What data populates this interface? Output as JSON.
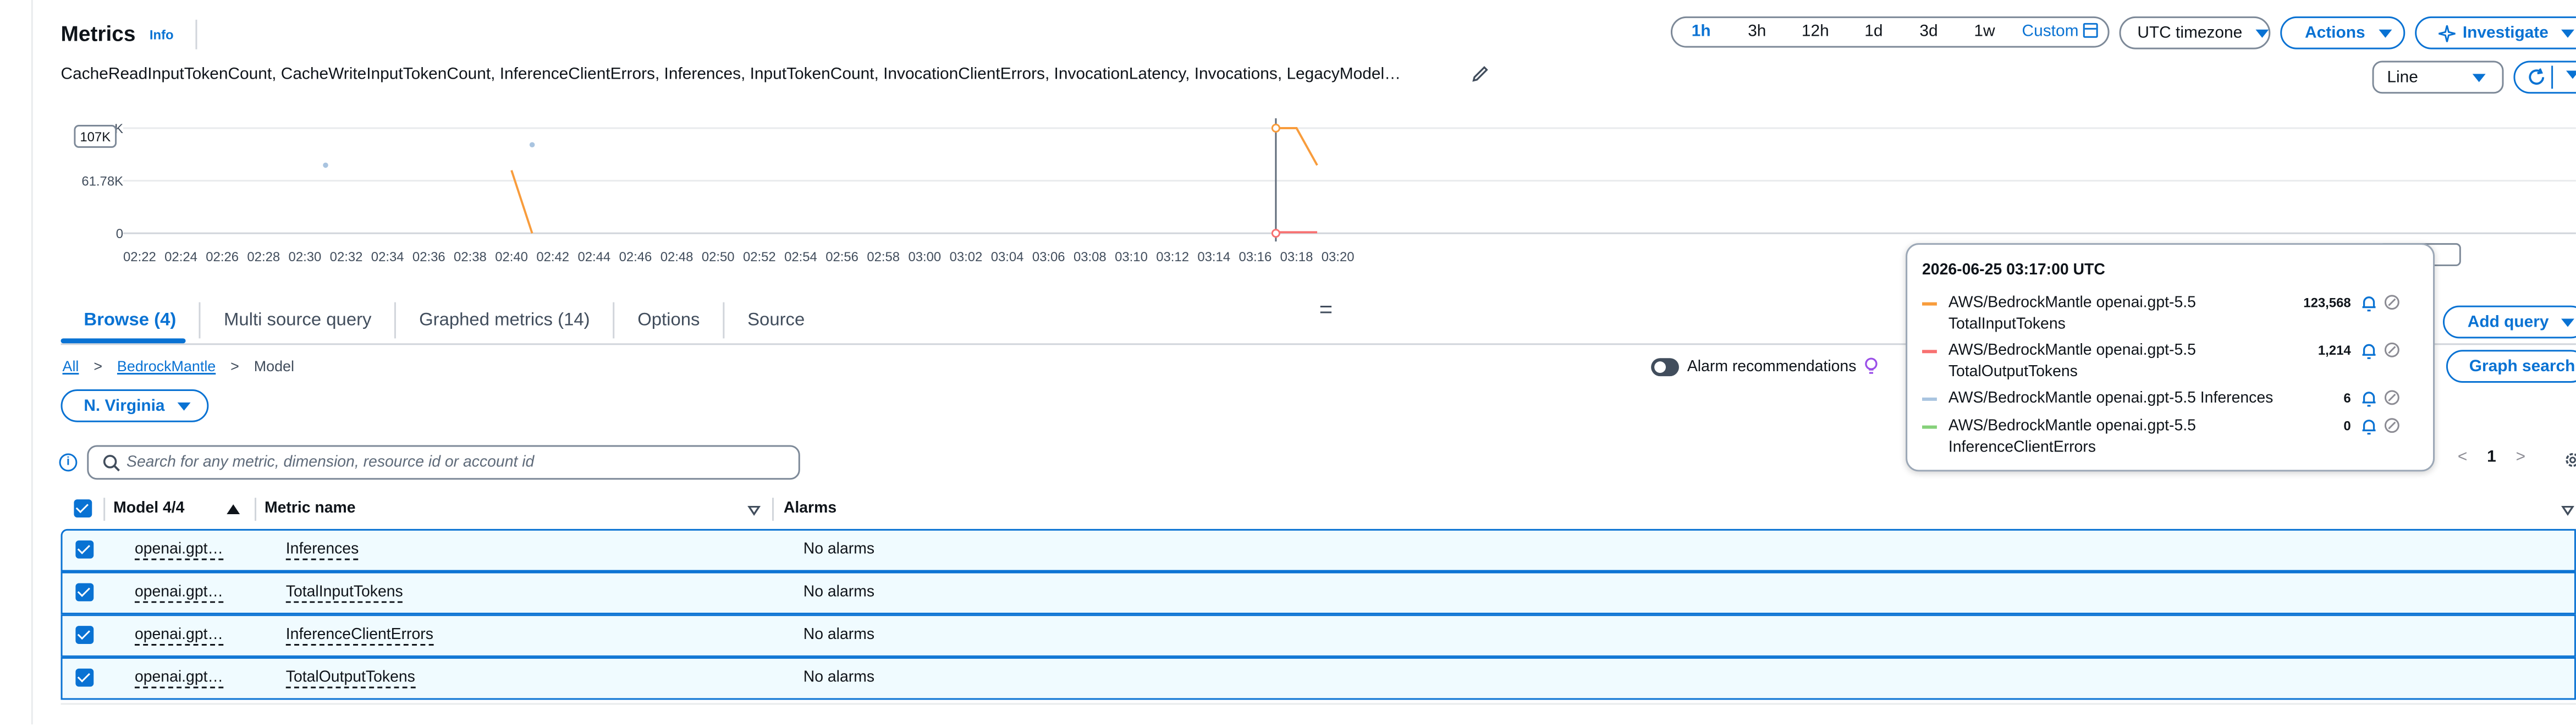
{
  "header": {
    "title": "Metrics",
    "info_link": "Info",
    "metric_list": "CacheReadInputTokenCount, CacheWriteInputTokenCount, InferenceClientErrors, Inferences, InputTokenCount, InvocationClientErrors, InvocationLatency, Invocations, LegacyModel…"
  },
  "time_range": {
    "options": [
      "1h",
      "3h",
      "12h",
      "1d",
      "3d",
      "1w"
    ],
    "selected": "1h",
    "custom_label": "Custom"
  },
  "toolbar": {
    "timezone": "UTC timezone",
    "actions": "Actions",
    "investigate": "Investigate",
    "graph_type": "Line",
    "add_query": "Add query",
    "graph_search": "Graph search"
  },
  "chart": {
    "hover_y_label": "107K",
    "hover_x_label": "3:17",
    "y_ticks": [
      "K",
      "61.78K",
      "0"
    ],
    "x_ticks": [
      "02:22",
      "02:24",
      "02:26",
      "02:28",
      "02:30",
      "02:32",
      "02:34",
      "02:36",
      "02:38",
      "02:40",
      "02:42",
      "02:44",
      "02:46",
      "02:48",
      "02:50",
      "02:52",
      "02:54",
      "02:56",
      "02:58",
      "03:00",
      "03:02",
      "03:04",
      "03:06",
      "03:08",
      "03:10",
      "03:12",
      "03:14",
      "03:16",
      "03:18",
      "03:20"
    ],
    "colors": {
      "TotalInputTokens": "#f89c3c",
      "TotalOutputTokens": "#f87171",
      "Inferences": "#a9c4e0",
      "InferenceClientErrors": "#86d17a"
    }
  },
  "chart_data": {
    "type": "line",
    "x": [
      "02:31",
      "02:40",
      "02:41",
      "03:01",
      "03:17",
      "03:18",
      "03:19"
    ],
    "series": [
      {
        "name": "AWS/BedrockMantle openai.gpt-5.5 TotalInputTokens",
        "values": [
          null,
          74000,
          0,
          null,
          123568,
          123568,
          80000
        ]
      },
      {
        "name": "AWS/BedrockMantle openai.gpt-5.5 TotalOutputTokens",
        "values": [
          null,
          null,
          null,
          null,
          1214,
          1214,
          1214
        ]
      },
      {
        "name": "AWS/BedrockMantle openai.gpt-5.5 Inferences",
        "values": [
          80000,
          null,
          104000,
          null,
          6,
          null,
          null
        ]
      },
      {
        "name": "AWS/BedrockMantle openai.gpt-5.5 InferenceClientErrors",
        "values": [
          null,
          null,
          null,
          null,
          0,
          null,
          null
        ]
      }
    ],
    "ylim": [
      0,
      123568
    ]
  },
  "tabs": [
    {
      "label": "Browse (4)",
      "active": true
    },
    {
      "label": "Multi source query",
      "active": false
    },
    {
      "label": "Graphed metrics (14)",
      "active": false
    },
    {
      "label": "Options",
      "active": false
    },
    {
      "label": "Source",
      "active": false
    }
  ],
  "breadcrumb": {
    "all": "All",
    "namespace": "BedrockMantle",
    "current": "Model",
    "separator": ">"
  },
  "region": "N. Virginia",
  "alarm_recommendations": "Alarm recommendations",
  "search": {
    "placeholder": "Search for any metric, dimension, resource id or account id"
  },
  "pagination": {
    "prev": "<",
    "page": "1",
    "next": ">"
  },
  "table": {
    "headers": {
      "model": "Model 4/4",
      "metric_name": "Metric name",
      "alarms": "Alarms"
    },
    "rows": [
      {
        "model": "openai.gpt…",
        "metric": "Inferences",
        "alarms": "No alarms",
        "checked": true
      },
      {
        "model": "openai.gpt…",
        "metric": "TotalInputTokens",
        "alarms": "No alarms",
        "checked": true
      },
      {
        "model": "openai.gpt…",
        "metric": "InferenceClientErrors",
        "alarms": "No alarms",
        "checked": true
      },
      {
        "model": "openai.gpt…",
        "metric": "TotalOutputTokens",
        "alarms": "No alarms",
        "checked": true
      }
    ]
  },
  "tooltip": {
    "timestamp": "2026-06-25 03:17:00 UTC",
    "items": [
      {
        "line1": "AWS/BedrockMantle openai.gpt-5.5",
        "line2": "TotalInputTokens",
        "value": "123,568",
        "color": "#f89c3c"
      },
      {
        "line1": "AWS/BedrockMantle openai.gpt-5.5",
        "line2": "TotalOutputTokens",
        "value": "1,214",
        "color": "#f87171"
      },
      {
        "line1": "AWS/BedrockMantle openai.gpt-5.5 Inferences",
        "line2": "",
        "value": "6",
        "color": "#a9c4e0"
      },
      {
        "line1": "AWS/BedrockMantle openai.gpt-5.5",
        "line2": "InferenceClientErrors",
        "value": "0",
        "color": "#86d17a"
      }
    ]
  }
}
